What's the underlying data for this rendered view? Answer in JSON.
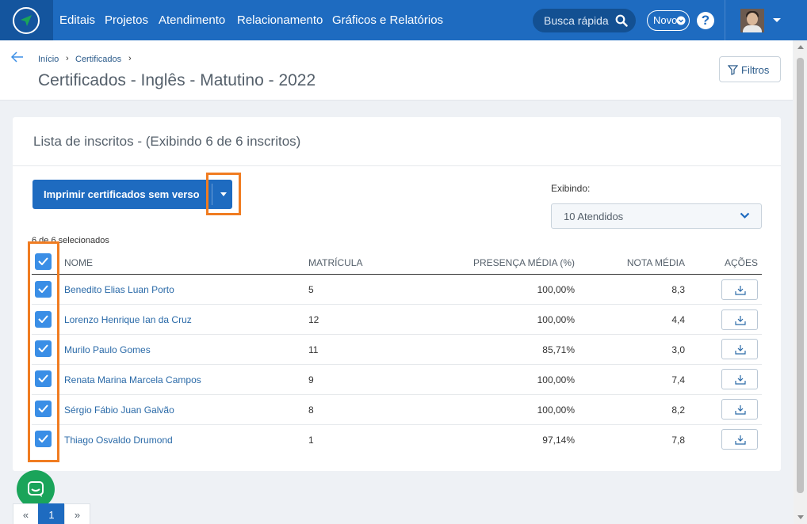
{
  "nav": {
    "links": [
      "Editais",
      "Projetos",
      "Atendimento",
      "Relacionamento",
      "Gráficos e Relatórios"
    ],
    "search_placeholder": "Busca rápida",
    "novo_label": "Novo",
    "help_label": "?"
  },
  "breadcrumb": [
    "Início",
    "Certificados"
  ],
  "page_title": "Certificados - Inglês - Matutino - 2022",
  "filtros_label": "Filtros",
  "card": {
    "title": "Lista de inscritos - (Exibindo 6 de 6 inscritos)",
    "print_button": "Imprimir certificados sem verso",
    "exibindo_label": "Exibindo:",
    "exibindo_value": "10 Atendidos",
    "selected_count": "6 de 6 selecionados"
  },
  "table": {
    "headers": [
      "NOME",
      "MATRÍCULA",
      "PRESENÇA MÉDIA (%)",
      "NOTA MÉDIA",
      "AÇÕES"
    ],
    "rows": [
      {
        "nome": "Benedito Elias Luan Porto",
        "matricula": "5",
        "presenca": "100,00%",
        "nota": "8,3"
      },
      {
        "nome": "Lorenzo Henrique Ian da Cruz",
        "matricula": "12",
        "presenca": "100,00%",
        "nota": "4,4"
      },
      {
        "nome": "Murilo Paulo Gomes",
        "matricula": "11",
        "presenca": "85,71%",
        "nota": "3,0"
      },
      {
        "nome": "Renata Marina Marcela Campos",
        "matricula": "9",
        "presenca": "100,00%",
        "nota": "7,4"
      },
      {
        "nome": "Sérgio Fábio Juan Galvão",
        "matricula": "8",
        "presenca": "100,00%",
        "nota": "8,2"
      },
      {
        "nome": "Thiago Osvaldo Drumond",
        "matricula": "1",
        "presenca": "97,14%",
        "nota": "7,8"
      }
    ]
  },
  "pagination": [
    "«",
    "1",
    "»"
  ],
  "colors": {
    "primary": "#1e6bc0",
    "highlight": "#f07c21",
    "checkbox": "#3a8ee6",
    "chat": "#1aa45a"
  }
}
